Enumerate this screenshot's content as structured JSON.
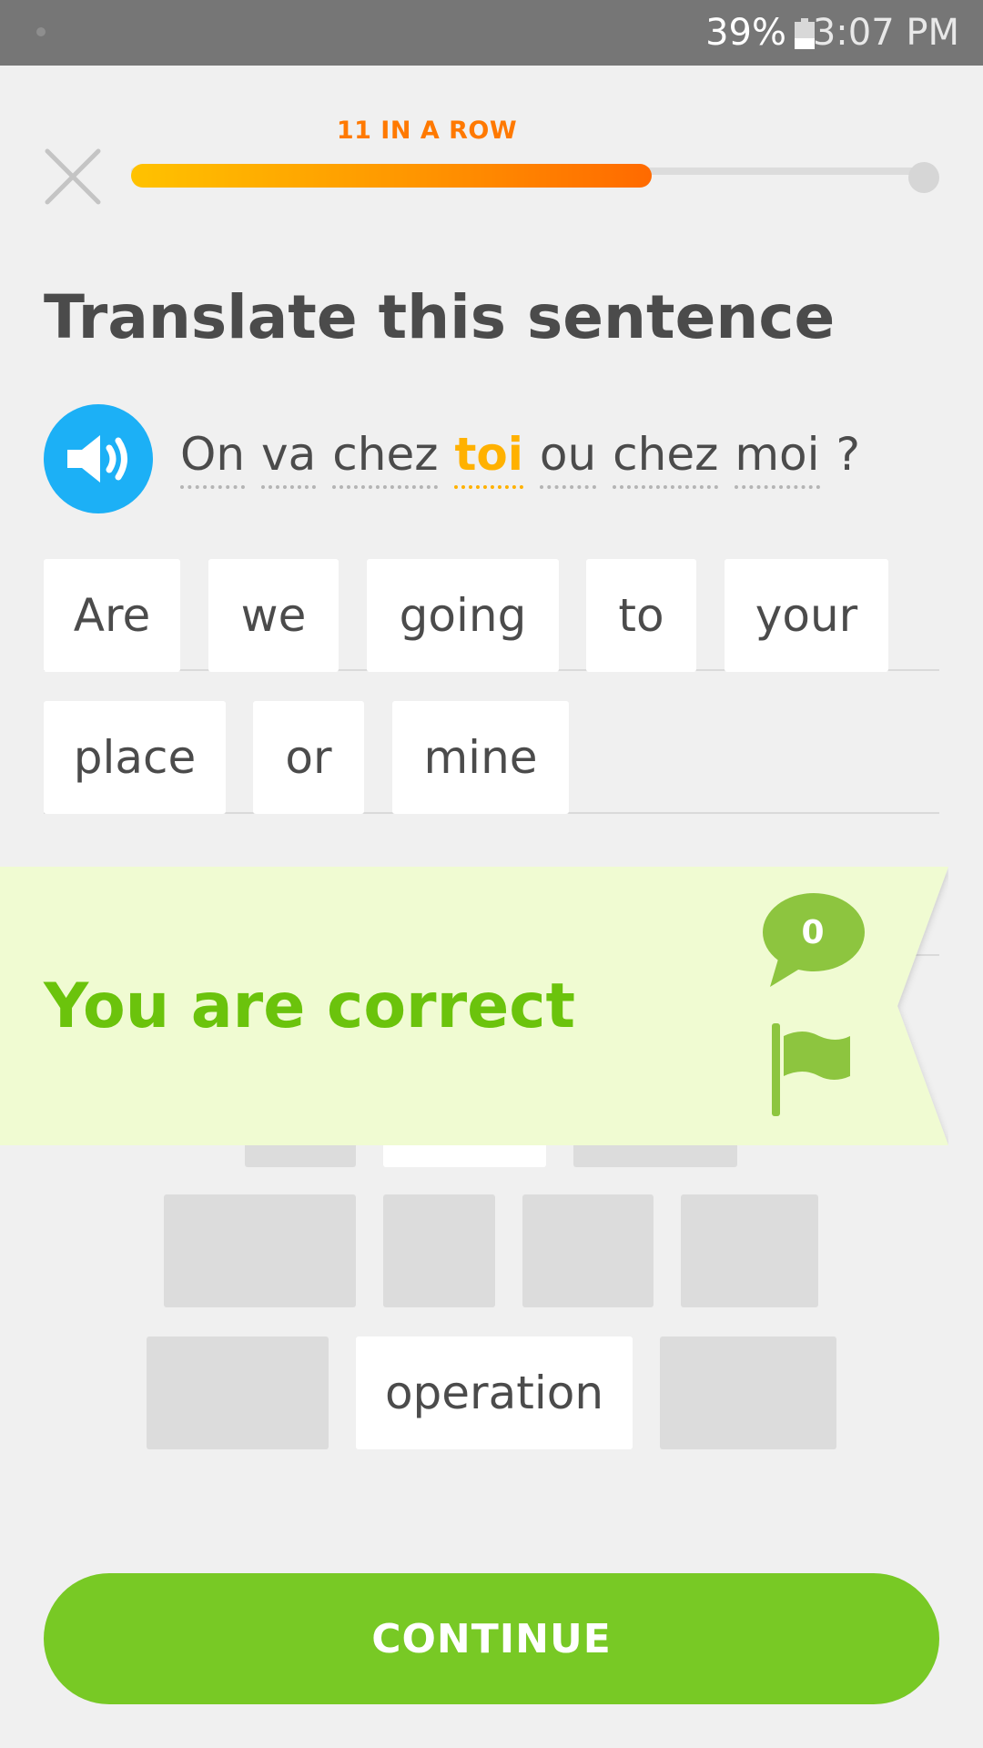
{
  "status_bar": {
    "battery": "39%",
    "battery_level": 0.39,
    "time": "3:07 PM"
  },
  "header": {
    "streak": "11 IN A ROW",
    "progress": 0.65
  },
  "prompt": {
    "title": "Translate this sentence"
  },
  "sentence": {
    "words": [
      "On",
      "va",
      "chez",
      "toi",
      "ou",
      "chez",
      "moi"
    ],
    "highlighted": "toi",
    "punctuation": "?"
  },
  "answer": {
    "tokens": [
      "Are",
      "we",
      "going",
      "to",
      "your",
      "place",
      "or",
      "mine"
    ]
  },
  "word_bank": {
    "visible_token": "operation"
  },
  "feedback": {
    "message": "You are correct",
    "comment_count": "0"
  },
  "footer": {
    "continue_label": "CONTINUE"
  },
  "colors": {
    "accent_green": "#78c925",
    "correct_text": "#6bc30c",
    "banner_bg": "#f0fbd2",
    "speaker_blue": "#1cb0f6",
    "streak_orange": "#ff7900",
    "highlight_yellow": "#ffb100"
  },
  "icons": {
    "close": "close-icon",
    "speaker": "speaker-icon",
    "comment": "comment-icon",
    "flag": "flag-icon"
  }
}
